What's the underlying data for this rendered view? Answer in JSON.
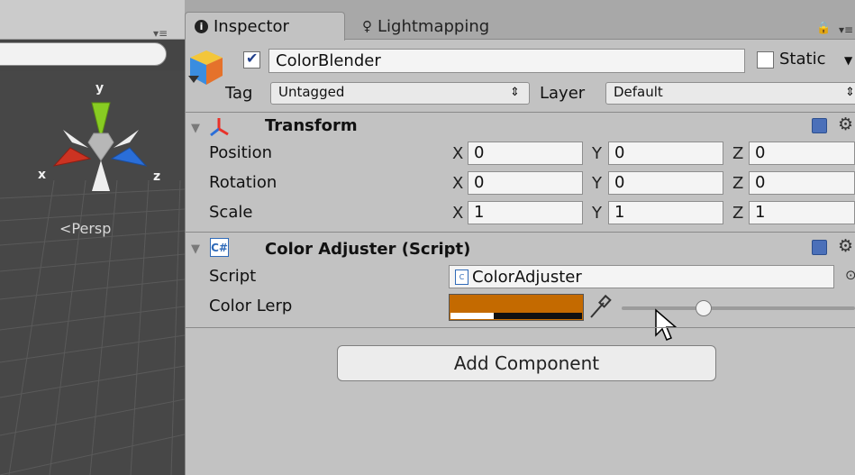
{
  "scene": {
    "persp_label": "Persp",
    "gizmo": {
      "x": "x",
      "y": "y",
      "z": "z"
    },
    "colors": {
      "x_axis": "#cc3322",
      "y_axis": "#88cc22",
      "z_axis": "#2a6ed8"
    }
  },
  "tabs": [
    {
      "label": "Inspector",
      "icon": "info-icon"
    },
    {
      "label": "Lightmapping",
      "icon": "bulb-icon"
    }
  ],
  "object": {
    "active": true,
    "name": "ColorBlender",
    "static_label": "Static",
    "static": false,
    "tag_label": "Tag",
    "tag_value": "Untagged",
    "layer_label": "Layer",
    "layer_value": "Default"
  },
  "transform": {
    "title": "Transform",
    "position_label": "Position",
    "rotation_label": "Rotation",
    "scale_label": "Scale",
    "axis_x": "X",
    "axis_y": "Y",
    "axis_z": "Z",
    "position": {
      "x": "0",
      "y": "0",
      "z": "0"
    },
    "rotation": {
      "x": "0",
      "y": "0",
      "z": "0"
    },
    "scale": {
      "x": "1",
      "y": "1",
      "z": "1"
    }
  },
  "color_adjuster": {
    "title": "Color Adjuster (Script)",
    "script_label": "Script",
    "script_value": "ColorAdjuster",
    "color_lerp_label": "Color Lerp",
    "color": "#c46a00",
    "alpha_fraction": 0.33,
    "slider_fraction": 0.35
  },
  "add_component_label": "Add Component"
}
